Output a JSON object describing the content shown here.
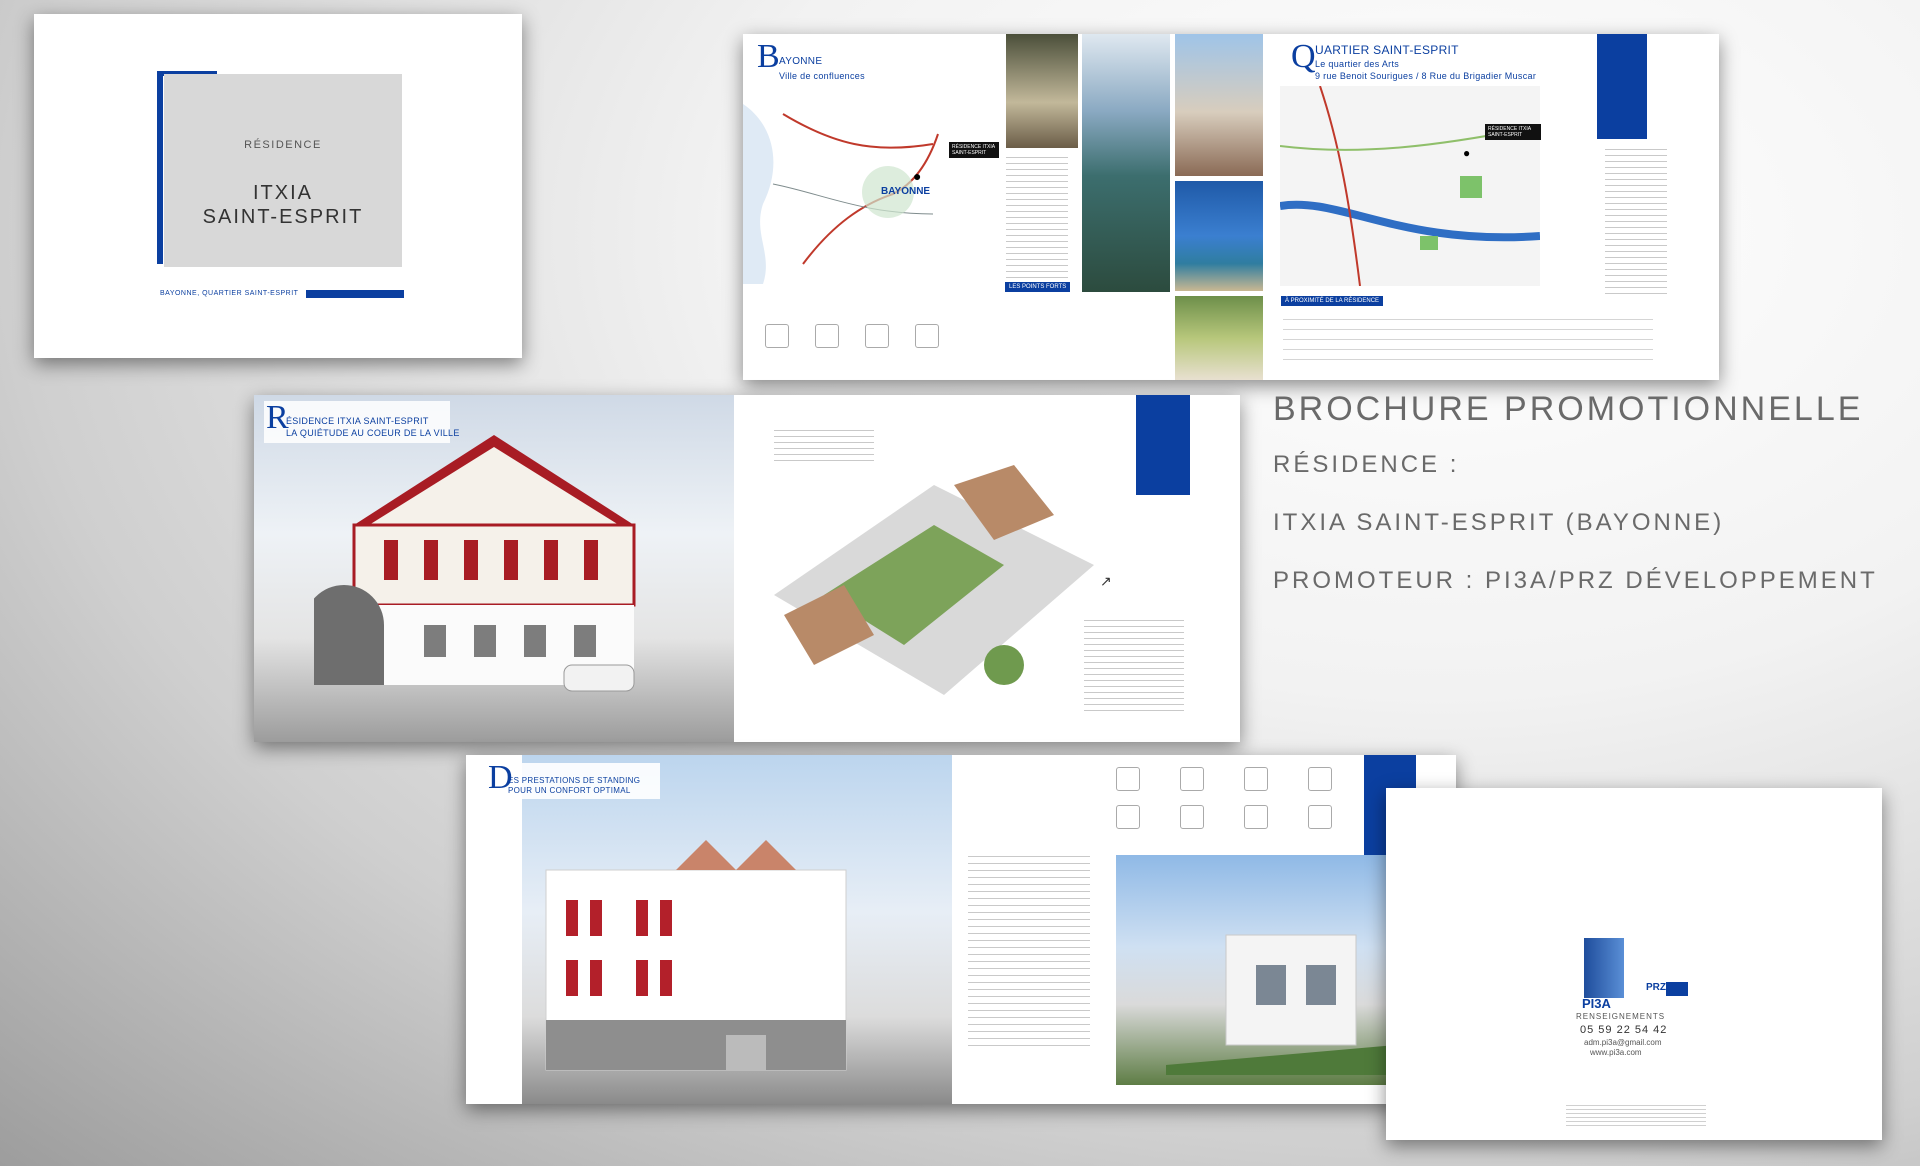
{
  "cover": {
    "kicker": "RÉSIDENCE",
    "title_line1": "ITXIA",
    "title_line2": "SAINT-ESPRIT",
    "location": "BAYONNE, QUARTIER SAINT-ESPRIT"
  },
  "spread1": {
    "left_letter": "B",
    "left_title": "AYONNE",
    "left_subtitle": "Ville de confluences",
    "map_city": "BAYONNE",
    "map_pin_label": "RÉSIDENCE ITXIA SAINT-ESPRIT",
    "points_forts": "LES POINTS FORTS",
    "right_letter": "Q",
    "right_title": "UARTIER SAINT-ESPRIT",
    "right_sub1": "Le quartier des Arts",
    "right_sub2": "9 rue Benoit Sourigues / 8 Rue du Brigadier Muscar",
    "right_pin_label": "RÉSIDENCE ITXIA SAINT-ESPRIT",
    "proximite": "À PROXIMITÉ DE LA RÉSIDENCE"
  },
  "spread2": {
    "letter": "R",
    "title": "ÉSIDENCE ITXIA SAINT-ESPRIT",
    "subtitle": "LA QUIÉTUDE AU COEUR DE LA VILLE"
  },
  "spread3": {
    "letter": "D",
    "title": "ES PRESTATIONS DE STANDING",
    "subtitle": "POUR UN CONFORT OPTIMAL"
  },
  "back": {
    "logo1": "PI3A",
    "logo2": "PRZ",
    "renseignements": "RENSEIGNEMENTS",
    "phone": "05 59 22 54 42",
    "email": "adm.pi3a@gmail.com",
    "web": "www.pi3a.com"
  },
  "caption": {
    "title": "BROCHURE PROMOTIONNELLE",
    "line1": "RÉSIDENCE :",
    "line2": "ITXIA SAINT-ESPRIT (BAYONNE)",
    "line3": "PROMOTEUR : PI3A/PRZ DÉVELOPPEMENT"
  },
  "colors": {
    "accent": "#0b3fa0",
    "shutter_red": "#a81c24"
  }
}
